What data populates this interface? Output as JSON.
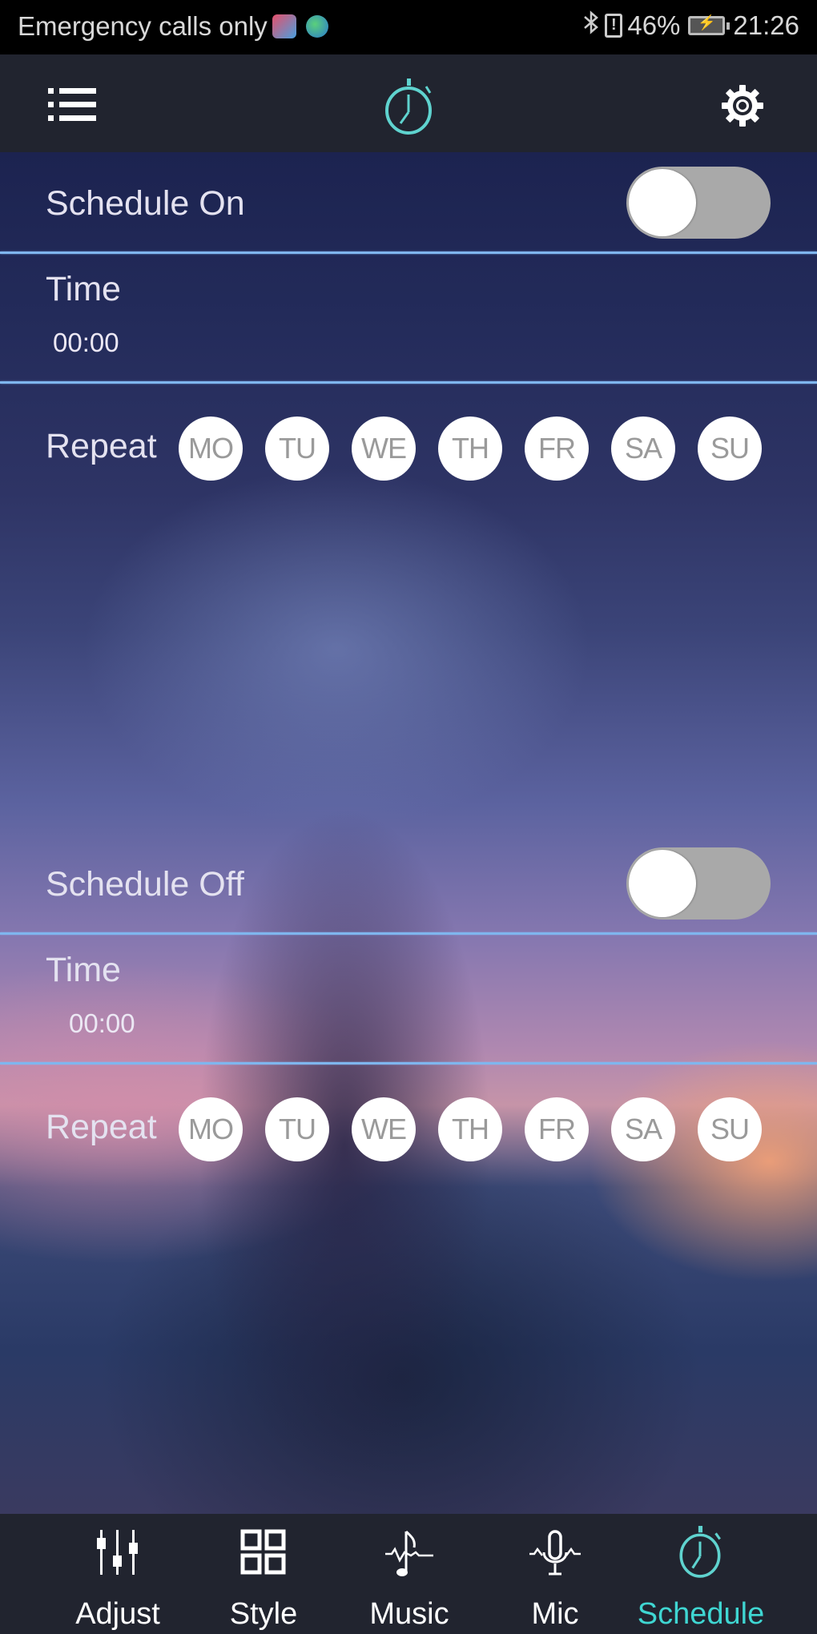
{
  "status_bar": {
    "carrier_text": "Emergency calls only",
    "battery_percent": "46%",
    "time": "21:26",
    "icons": [
      "app-notification-icon",
      "globe-app-icon",
      "bluetooth-icon",
      "sim-alert-icon",
      "battery-charging-icon"
    ]
  },
  "app_bar": {
    "left_icon": "menu-list-icon",
    "center_icon": "stopwatch-icon",
    "right_icon": "gear-icon",
    "accent_color": "#3fd6d2"
  },
  "schedule_on": {
    "label": "Schedule On",
    "enabled": false,
    "time_label": "Time",
    "time_value": "00:00",
    "repeat_label": "Repeat",
    "days": [
      "MO",
      "TU",
      "WE",
      "TH",
      "FR",
      "SA",
      "SU"
    ]
  },
  "schedule_off": {
    "label": "Schedule Off",
    "enabled": false,
    "time_label": "Time",
    "time_value": "00:00",
    "repeat_label": "Repeat",
    "days": [
      "MO",
      "TU",
      "WE",
      "TH",
      "FR",
      "SA",
      "SU"
    ]
  },
  "bottom_nav": {
    "active": "Schedule",
    "items": [
      {
        "label": "Adjust",
        "icon": "sliders-icon"
      },
      {
        "label": "Style",
        "icon": "grid-icon"
      },
      {
        "label": "Music",
        "icon": "music-note-icon"
      },
      {
        "label": "Mic",
        "icon": "microphone-icon"
      },
      {
        "label": "Schedule",
        "icon": "stopwatch-icon"
      }
    ]
  }
}
